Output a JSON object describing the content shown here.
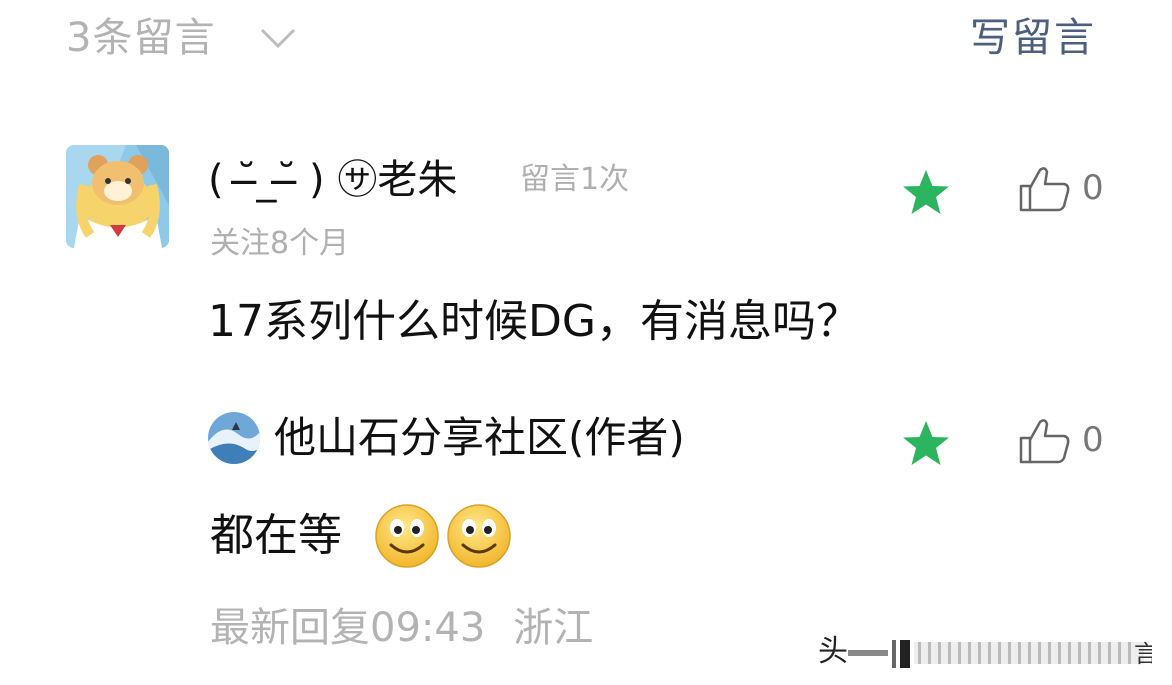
{
  "header": {
    "comment_count": "3条留言",
    "write_comment": "写留言"
  },
  "comment": {
    "username": "( ˘̶_˘̶ ) ㋚老朱",
    "comment_count_meta": "留言1次",
    "follow_time": "关注8个月",
    "text": "17系列什么时候DG，有消息吗？",
    "like_count": "0"
  },
  "reply": {
    "author": "他山石分享社区(作者)",
    "text": "都在等",
    "like_count": "0",
    "latest_reply": "最新回复09:43",
    "location": "浙江"
  },
  "watermark": {
    "text": "头"
  },
  "colors": {
    "star": "#2bb55f",
    "meta_gray": "#b0b0b0",
    "link_blue": "#4d5f7e"
  }
}
